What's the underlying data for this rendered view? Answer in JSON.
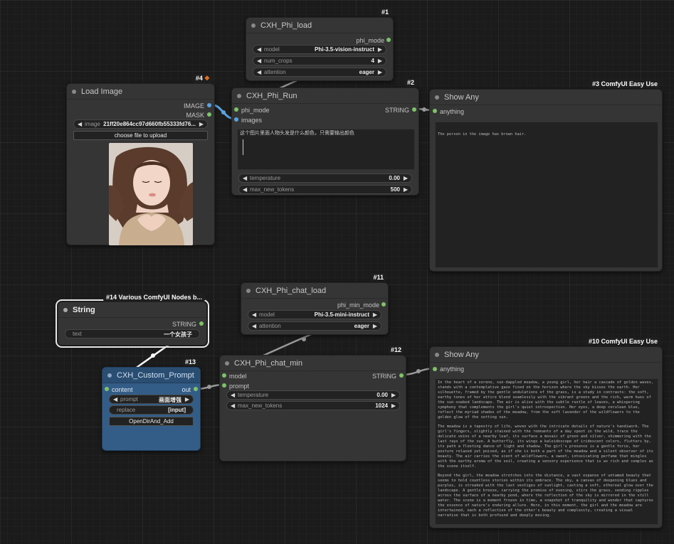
{
  "nodes": {
    "phi_load": {
      "id": "#1",
      "title": "CXH_Phi_load",
      "output": "phi_mode",
      "widgets": {
        "model": {
          "label": "model",
          "value": "Phi-3.5-vision-instruct"
        },
        "num_crops": {
          "label": "num_crops",
          "value": "4"
        },
        "attention": {
          "label": "attention",
          "value": "eager"
        }
      }
    },
    "load_image": {
      "id": "#4",
      "title": "Load Image",
      "outputs": {
        "image": "IMAGE",
        "mask": "MASK"
      },
      "image_widget": {
        "label": "image",
        "value": "21ff20e864cc97d660fb55333fd76..."
      },
      "upload_button": "choose file to upload",
      "preview_alt": "Uploaded portrait preview"
    },
    "phi_run": {
      "id": "#2",
      "title": "CXH_Phi_Run",
      "inputs": {
        "phi_mode": "phi_mode",
        "images": "images"
      },
      "output": "STRING",
      "prompt_text": "这个图片里面人物头发是什么颜色，只需要输出颜色",
      "widgets": {
        "temperature": {
          "label": "temperature",
          "value": "0.00"
        },
        "max_new_tokens": {
          "label": "max_new_tokens",
          "value": "500"
        }
      }
    },
    "show_any_1": {
      "id": "#3 ComfyUI Easy Use",
      "title": "Show Any",
      "input": "anything",
      "text": "The person in the image has brown hair."
    },
    "chat_load": {
      "id": "#11",
      "title": "CXH_Phi_chat_load",
      "output": "phi_min_mode",
      "widgets": {
        "model": {
          "label": "model",
          "value": "Phi-3.5-mini-instruct"
        },
        "attention": {
          "label": "attention",
          "value": "eager"
        }
      }
    },
    "string_node": {
      "id": "#14 Various ComfyUI Nodes b...",
      "title": "String",
      "output": "STRING",
      "widget": {
        "label": "text",
        "value": "一个女孩子"
      }
    },
    "custom_prompt": {
      "id": "#13",
      "title": "CXH_Custom_Prompt",
      "input": "content",
      "output": "out",
      "widgets": {
        "prompt": {
          "label": "prompt",
          "value": "画面增强"
        },
        "replace": {
          "label": "replace",
          "value": "[input]"
        }
      },
      "button": "OpenDirAnd_Add"
    },
    "chat_min": {
      "id": "#12",
      "title": "CXH_Phi_chat_min",
      "inputs": {
        "model": "model",
        "prompt": "prompt"
      },
      "output": "STRING",
      "widgets": {
        "temperature": {
          "label": "temperature",
          "value": "0.00"
        },
        "max_new_tokens": {
          "label": "max_new_tokens",
          "value": "1024"
        }
      }
    },
    "show_any_2": {
      "id": "#10 ComfyUI Easy Use",
      "title": "Show Any",
      "input": "anything",
      "paragraphs": [
        "In the heart of a serene, sun-dappled meadow, a young girl, her hair a cascade of golden waves, stands with a contemplative gaze fixed on the horizon where the sky kisses the earth. Her silhouette, framed by the gentle undulations of the grass, is a study in contrasts: the soft, earthy tones of her attire blend seamlessly with the vibrant greens and the rich, warm hues of the sun-soaked landscape. The air is alive with the subtle rustle of leaves, a whispering symphony that complements the girl's quiet introspection. Her eyes, a deep cerulean blue, reflect the myriad shades of the meadow, from the soft lavender of the wildflowers to the golden glow of the setting sun.",
        "The meadow is a tapestry of life, woven with the intricate details of nature's handiwork. The girl's fingers, slightly stained with the remnants of a day spent in the wild, trace the delicate veins of a nearby leaf, its surface a mosaic of green and silver, shimmering with the last rays of the sun. A butterfly, its wings a kaleidoscope of iridescent colors, flutters by, its path a fleeting dance of light and shadow. The girl's presence is a gentle force, her posture relaxed yet poised, as if she is both a part of the meadow and a silent observer of its beauty. The air carries the scent of wildflowers, a sweet, intoxicating perfume that mingles with the earthy aroma of the soil, creating a sensory experience that is as rich and complex as the scene itself.",
        "Beyond the girl, the meadow stretches into the distance, a vast expanse of untamed beauty that seems to hold countless stories within its embrace. The sky, a canvas of deepening blues and purples, is streaked with the last vestiges of sunlight, casting a soft, ethereal glow over the landscape. A gentle breeze, carrying the promise of evening, stirs the grass, sending ripples across the surface of a nearby pond, where the reflection of the sky is mirrored in the still water. The scene is a moment frozen in time, a snapshot of tranquility and wonder that captures the essence of nature's enduring allure. Here, in this moment, the girl and the meadow are intertwined, each a reflection of the other's beauty and complexity, creating a visual narrative that is both profound and deeply moving."
      ]
    }
  }
}
